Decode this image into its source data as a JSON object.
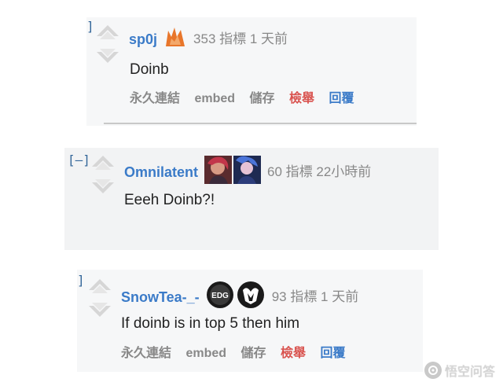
{
  "comments": [
    {
      "collapse": "]",
      "author": "sp0j",
      "score": "353 指標 1 天前",
      "body": "Doinb",
      "flairs": [
        "team-flair-icon"
      ],
      "buttons": {
        "permalink": "永久連結",
        "embed": "embed",
        "save": "儲存",
        "report": "檢舉",
        "reply": "回覆"
      }
    },
    {
      "collapse": "[–]",
      "author": "Omnilatent",
      "score": "60 指標 22小時前",
      "body": "Eeeh Doinb?!",
      "flairs": [
        "champion-vi-icon",
        "champion-jinx-icon"
      ]
    },
    {
      "collapse": "]",
      "author": "SnowTea-_-",
      "score": "93 指標 1 天前",
      "body": "If doinb is in top 5 then him",
      "flairs": [
        "edg-logo-icon",
        "ig-logo-icon"
      ],
      "flair_text": "EDG",
      "buttons": {
        "permalink": "永久連結",
        "embed": "embed",
        "save": "儲存",
        "report": "檢舉",
        "reply": "回覆"
      }
    }
  ],
  "watermark": {
    "text": "悟空问答"
  },
  "colors": {
    "author": "#3b7bc8",
    "report": "#d9534f",
    "reply": "#3b7bc8",
    "meta": "#888888"
  }
}
